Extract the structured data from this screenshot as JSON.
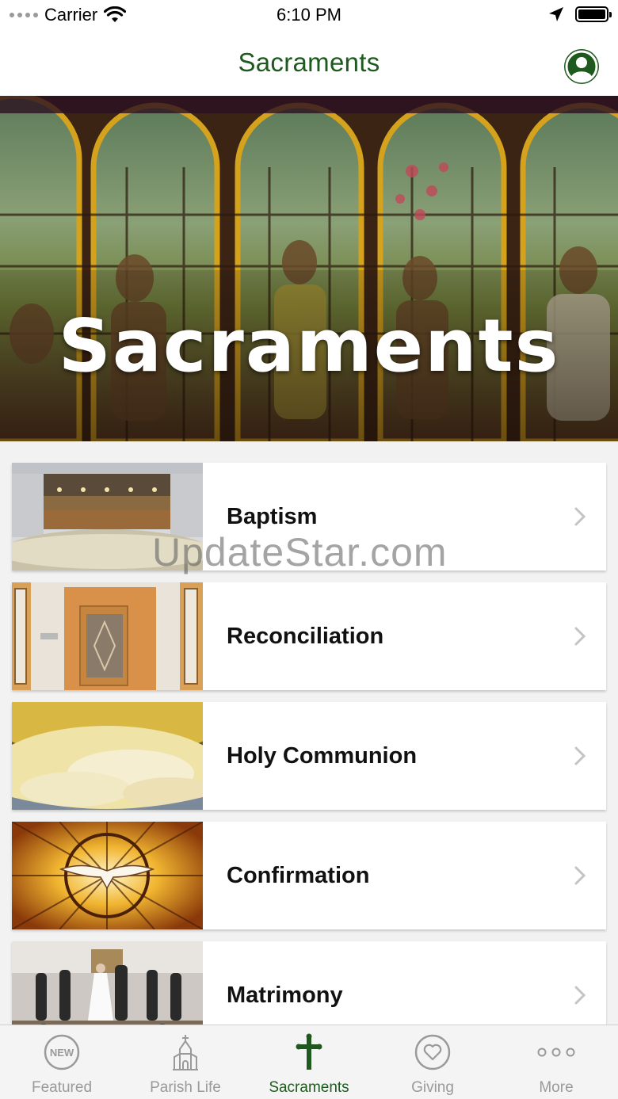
{
  "status_bar": {
    "carrier": "Carrier",
    "time": "6:10 PM"
  },
  "nav": {
    "title": "Sacraments"
  },
  "hero": {
    "title": "Sacraments"
  },
  "watermark": "UpdateStar.com",
  "sacraments": [
    {
      "label": "Baptism"
    },
    {
      "label": "Reconciliation"
    },
    {
      "label": "Holy Communion"
    },
    {
      "label": "Confirmation"
    },
    {
      "label": "Matrimony"
    }
  ],
  "tabs": [
    {
      "label": "Featured",
      "icon": "new-badge-icon",
      "badge": "NEW"
    },
    {
      "label": "Parish Life",
      "icon": "church-icon"
    },
    {
      "label": "Sacraments",
      "icon": "cross-icon",
      "active": true
    },
    {
      "label": "Giving",
      "icon": "heart-icon"
    },
    {
      "label": "More",
      "icon": "more-dots-icon"
    }
  ],
  "colors": {
    "accent": "#1e5a1e",
    "inactive": "#9a9a9a"
  }
}
